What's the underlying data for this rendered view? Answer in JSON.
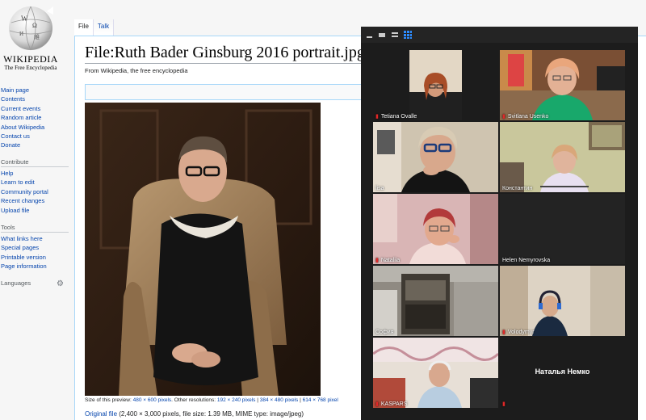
{
  "wiki": {
    "wordmark": "Wikipedia",
    "tagline": "The Free Encyclopedia",
    "nav_main": [
      "Main page",
      "Contents",
      "Current events",
      "Random article",
      "About Wikipedia",
      "Contact us",
      "Donate"
    ],
    "contribute_heading": "Contribute",
    "nav_contribute": [
      "Help",
      "Learn to edit",
      "Community portal",
      "Recent changes",
      "Upload file"
    ],
    "tools_heading": "Tools",
    "nav_tools": [
      "What links here",
      "Special pages",
      "Printable version",
      "Page information"
    ],
    "languages_heading": "Languages",
    "tabs": [
      "File",
      "Talk"
    ],
    "page_title": "File:Ruth Bader Ginsburg 2016 portrait.jpg",
    "from_line": "From Wikipedia, the free encyclopedia",
    "preview_prefix": "Size of this preview:",
    "preview_size": "480 × 600 pixels",
    "other_res_prefix": ". Other resolutions:",
    "other_resolutions": [
      "192 × 240 pixels",
      "384 × 480 pixels",
      "614 × 768 pixel"
    ],
    "original_file_link": "Original file",
    "original_file_info": "(2,400 × 3,000 pixels, file size: 1.39 MB, MIME type: image/jpeg)"
  },
  "zoom": {
    "participants": [
      {
        "name": "Tetiana Ovalle",
        "muted": true,
        "video": true,
        "active": false
      },
      {
        "name": "Svitlana Usenko",
        "muted": true,
        "video": true,
        "active": false
      },
      {
        "name": "lisa",
        "muted": false,
        "video": true,
        "active": true
      },
      {
        "name": "Константин",
        "muted": false,
        "video": true,
        "active": false
      },
      {
        "name": "Nataliia",
        "muted": true,
        "video": true,
        "active": false
      },
      {
        "name": "Helen Nemyrovska",
        "muted": false,
        "video": false,
        "active": false
      },
      {
        "name": "София",
        "muted": false,
        "video": true,
        "active": false
      },
      {
        "name": "Volodymyr",
        "muted": true,
        "video": true,
        "active": false
      },
      {
        "name": "KASPARS",
        "muted": true,
        "video": true,
        "active": false
      },
      {
        "name": "Наталья Немко",
        "muted": true,
        "video": false,
        "active": false
      }
    ],
    "active_border_color": "#c8e000",
    "muted_icon": "mic-muted-icon"
  }
}
